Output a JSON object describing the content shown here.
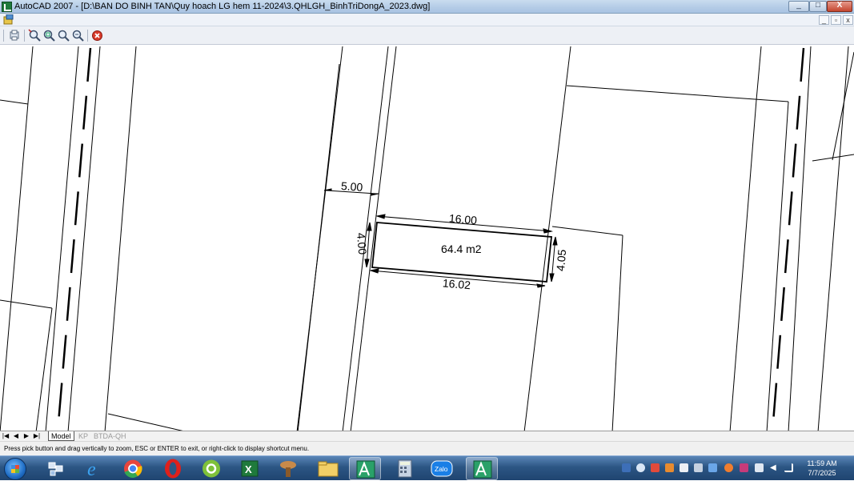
{
  "window": {
    "title": "AutoCAD 2007 - [D:\\BAN DO BINH TAN\\Quy hoach LG hem 11-2024\\3.QHLGH_BinhTriDongA_2023.dwg]",
    "minimize_glyph": "_",
    "maximize_glyph": "□",
    "close_glyph": "X",
    "doc_minimize_glyph": "_",
    "doc_restore_glyph": "▫",
    "doc_close_glyph": "x"
  },
  "toolbar": {
    "icons": [
      "pan-realtime-icon",
      "zoom-realtime-icon",
      "zoom-window-icon",
      "zoom-previous-icon",
      "zoom-extents-icon",
      "close-preview-icon"
    ]
  },
  "drawing": {
    "area_label": "64.4 m2",
    "dim_top": "16.00",
    "dim_bottom": "16.02",
    "dim_left": "4.00",
    "dim_right": "4.05",
    "dim_road": "5.00",
    "line_color": "#000000",
    "background": "#ffffff"
  },
  "layout_tabs": {
    "nav_first": "|◀",
    "nav_prev": "◀",
    "nav_next": "▶",
    "nav_last": "▶|",
    "tabs": [
      {
        "label": "Model",
        "active": true
      },
      {
        "label": "KP",
        "active": false
      },
      {
        "label": "BTDA-QH",
        "active": false
      }
    ]
  },
  "status": {
    "prompt": "Press pick button and drag vertically to zoom, ESC or ENTER to exit, or right-click to display shortcut menu."
  },
  "taskbar": {
    "start_icon": "windows-start-orb-icon",
    "apps": [
      {
        "name": "network-manager-icon",
        "active": false
      },
      {
        "name": "internet-explorer-icon",
        "active": false
      },
      {
        "name": "chrome-icon",
        "active": false
      },
      {
        "name": "opera-icon",
        "active": false
      },
      {
        "name": "coccoc-icon",
        "active": false
      },
      {
        "name": "excel-icon",
        "active": false
      },
      {
        "name": "app-icon",
        "active": false
      },
      {
        "name": "file-explorer-icon",
        "active": false
      },
      {
        "name": "autocad-icon",
        "active": true
      },
      {
        "name": "calculator-icon",
        "active": false
      },
      {
        "name": "zalo-icon",
        "active": false,
        "label": "Zalo"
      },
      {
        "name": "autocad-icon-2",
        "active": true
      }
    ],
    "clock_time": "11:59 AM",
    "clock_date": "7/7/2025"
  },
  "colors": {
    "title_bar": "#b3cbe6",
    "taskbar": "#2c5684",
    "close_button": "#c4452f"
  }
}
